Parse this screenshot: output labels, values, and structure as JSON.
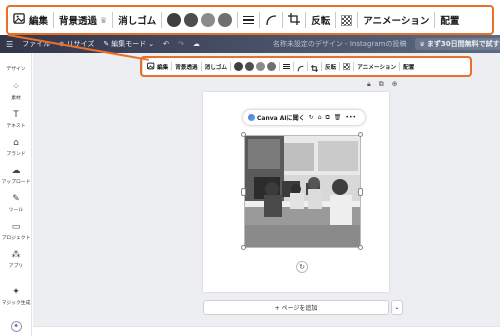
{
  "colors": {
    "callout": "#e8712a",
    "swatches": [
      "#3f3f3f",
      "#4e4e4e",
      "#8b8b8b",
      "#6f6f6f"
    ]
  },
  "zoom_toolbar": {
    "edit_label": "編集",
    "remove_bg_label": "背景透過",
    "remove_bg_badge": "♛",
    "magic_eraser_label": "消しゴム",
    "flip_label": "反転",
    "animate_label": "アニメーション",
    "position_label": "配置",
    "icons": [
      "image-edit-icon",
      "border-style-icon",
      "corner-rounding-icon",
      "crop-icon",
      "transparency-icon"
    ]
  },
  "header": {
    "menu_icon": "hamburger-icon",
    "file": "ファイル",
    "resize": "リサイズ",
    "edit_mode": "編集モード",
    "doc_title": "名称未設定のデザイン - Instagramの投稿",
    "trial": "まず30日間無料で試す"
  },
  "sidebar": {
    "items": [
      {
        "label": "デザイン",
        "icon": "layout-icon"
      },
      {
        "label": "素材",
        "icon": "elements-icon"
      },
      {
        "label": "テキスト",
        "icon": "text-icon"
      },
      {
        "label": "ブランド",
        "icon": "brand-icon"
      },
      {
        "label": "アップロード",
        "icon": "upload-icon"
      },
      {
        "label": "ツール",
        "icon": "draw-icon"
      },
      {
        "label": "プロジェクト",
        "icon": "folder-icon"
      },
      {
        "label": "アプリ",
        "icon": "apps-icon"
      },
      {
        "label": "マジック生成",
        "icon": "magic-icon"
      }
    ]
  },
  "context_toolbar": {
    "edit_label": "編集",
    "remove_bg_label": "背景透過",
    "magic_eraser_label": "消しゴム",
    "flip_label": "反転",
    "animate_label": "アニメーション",
    "position_label": "配置"
  },
  "float_toolbar": {
    "ai_label": "Canva AIに聞く"
  },
  "add_page_label": "+ ページを追加"
}
